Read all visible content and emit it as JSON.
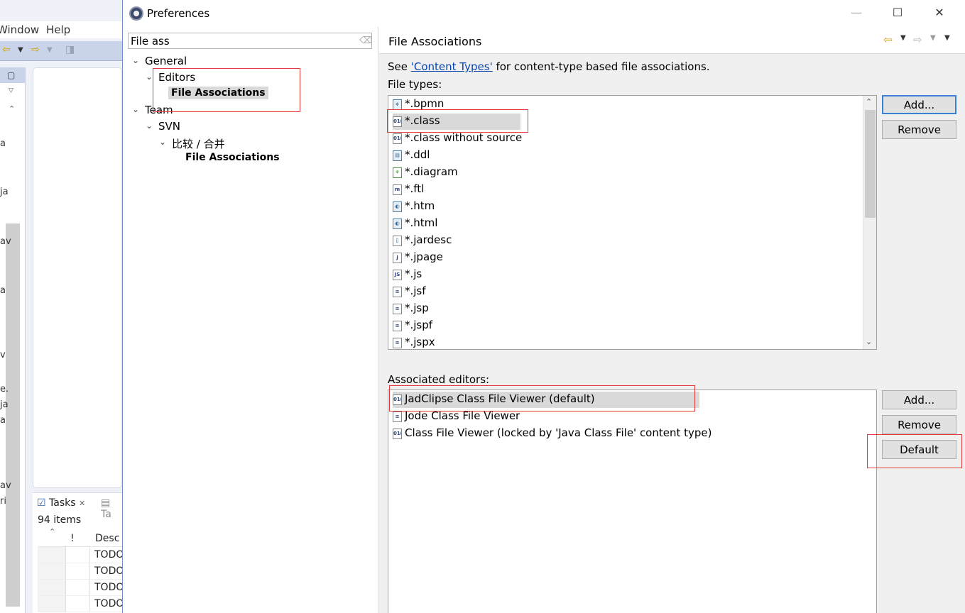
{
  "background": {
    "menu": [
      "Window",
      "Help"
    ],
    "clipped_text": [
      "a",
      "ja",
      "av",
      "a",
      "v",
      "e.",
      "ja",
      "a",
      "av",
      "ri"
    ],
    "tasks": {
      "tab_label": "Tasks",
      "tab2_label": "Ta",
      "count": "94 items",
      "col_priority": "!",
      "col_desc": "Desc",
      "rows": [
        "TODO",
        "TODO",
        "TODO",
        "TODO"
      ]
    }
  },
  "dialog": {
    "title": "Preferences",
    "filter": {
      "value": "File ass"
    },
    "tree": [
      {
        "label": "General",
        "depth": 0,
        "expanded": true,
        "bold": false,
        "selected": false
      },
      {
        "label": "Editors",
        "depth": 1,
        "expanded": true,
        "bold": false,
        "selected": false
      },
      {
        "label": "File Associations",
        "depth": 2,
        "expanded": false,
        "bold": true,
        "selected": true
      },
      {
        "label": "Team",
        "depth": 0,
        "expanded": true,
        "bold": false,
        "selected": false
      },
      {
        "label": "SVN",
        "depth": 1,
        "expanded": true,
        "bold": false,
        "selected": false
      },
      {
        "label": "比较 / 合并",
        "depth": 2,
        "expanded": true,
        "bold": false,
        "selected": false
      },
      {
        "label": "File Associations",
        "depth": 3,
        "expanded": false,
        "bold": true,
        "selected": false
      }
    ],
    "page": {
      "title": "File Associations",
      "see_prefix": "See ",
      "see_link": "'Content Types'",
      "see_suffix": " for content-type based file associations.",
      "file_types_label": "File types:",
      "file_types": [
        {
          "name": "*.bpmn",
          "icon": "bpmn-icon"
        },
        {
          "name": "*.class",
          "icon": "class-file-icon"
        },
        {
          "name": "*.class without source",
          "icon": "class-file-icon"
        },
        {
          "name": "*.ddl",
          "icon": "ddl-file-icon"
        },
        {
          "name": "*.diagram",
          "icon": "diagram-icon"
        },
        {
          "name": "*.ftl",
          "icon": "ftl-file-icon"
        },
        {
          "name": "*.htm",
          "icon": "html-file-icon"
        },
        {
          "name": "*.html",
          "icon": "html-file-icon"
        },
        {
          "name": "*.jardesc",
          "icon": "jardesc-icon"
        },
        {
          "name": "*.jpage",
          "icon": "jpage-icon"
        },
        {
          "name": "*.js",
          "icon": "js-file-icon"
        },
        {
          "name": "*.jsf",
          "icon": "text-file-icon"
        },
        {
          "name": "*.jsp",
          "icon": "text-file-icon"
        },
        {
          "name": "*.jspf",
          "icon": "text-file-icon"
        },
        {
          "name": "*.jspx",
          "icon": "text-file-icon"
        }
      ],
      "selected_file_type": 1,
      "file_types_add": "Add...",
      "file_types_remove": "Remove",
      "associated_editors_label": "Associated editors:",
      "associated_editors": [
        {
          "name": "JadClipse Class File Viewer (default)",
          "icon": "class-file-icon"
        },
        {
          "name": "Jode Class File Viewer",
          "icon": "text-file-icon"
        },
        {
          "name": "Class File Viewer (locked by 'Java Class File' content type)",
          "icon": "class-file-icon"
        }
      ],
      "selected_editor": 0,
      "editors_add": "Add...",
      "editors_remove": "Remove",
      "editors_default": "Default"
    },
    "colors": {
      "accent": "#3c7fd6",
      "annotation": "#e23a3a",
      "selection": "#d9d9d9",
      "link": "#0645ad"
    }
  }
}
